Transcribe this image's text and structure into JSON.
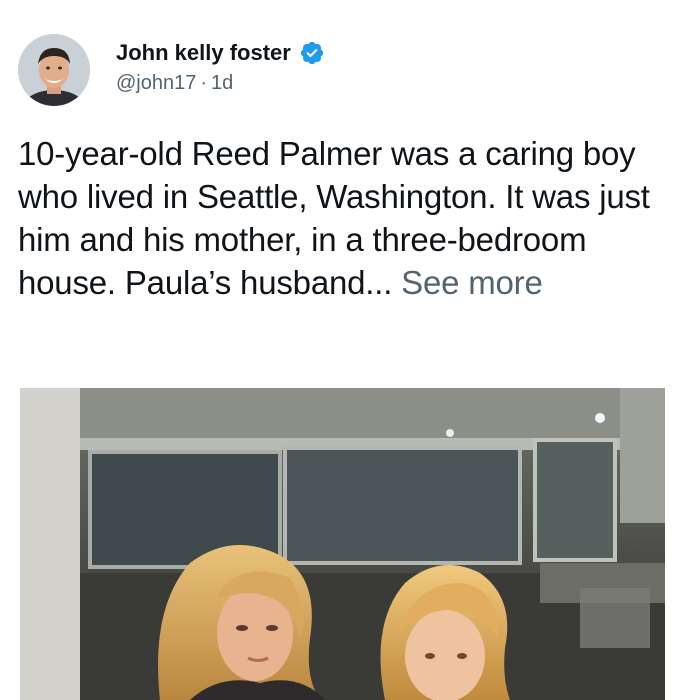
{
  "tweet": {
    "author": {
      "display_name": "John kelly foster",
      "handle": "@john17",
      "verified": true,
      "verified_icon": "verified-badge-icon",
      "avatar_icon": "avatar-photo"
    },
    "separator": "·",
    "time_ago": "1d",
    "text": "10-year-old Reed Palmer was a caring boy who lived in Seattle, Washington. It was just him and his mother, in a three-bedroom house. Paula’s husband... ",
    "see_more_label": "See more",
    "media": {
      "type": "photo"
    }
  },
  "colors": {
    "text_primary": "#0f1419",
    "text_secondary": "#536471",
    "verified_blue": "#1d9bf0"
  }
}
